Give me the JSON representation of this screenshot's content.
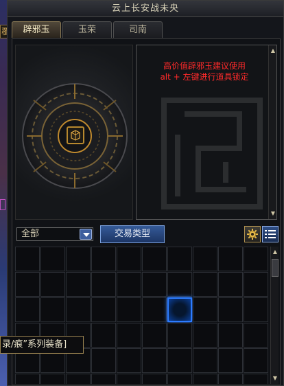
{
  "window": {
    "title": "云上长安战未央"
  },
  "tabs": [
    {
      "label": "辟邪玉",
      "active": true
    },
    {
      "label": "玉荣",
      "active": false
    },
    {
      "label": "司南",
      "active": false
    }
  ],
  "info": {
    "line1": "高价值辟邪玉建议使用",
    "line2": "alt + 左键进行道具锁定"
  },
  "toolbar": {
    "filter_selected": "全部",
    "trade_type_label": "交易类型"
  },
  "tooltip": {
    "text": "录/痕”系列装备]"
  },
  "side_tag": {
    "text": "覆"
  },
  "colors": {
    "accent_gold": "#b8892e",
    "accent_blue": "#2d7cff",
    "warning_red": "#ff2a2a"
  }
}
